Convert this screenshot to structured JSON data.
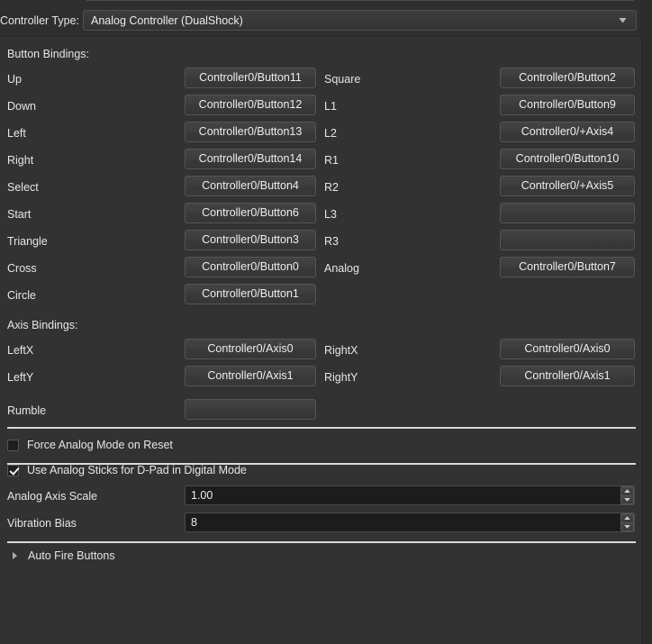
{
  "header": {
    "controller_type_label": "Controller Type:",
    "controller_type_value": "Analog Controller (DualShock)",
    "dropdown_icon": "chevron-down-icon"
  },
  "button_bindings": {
    "title": "Button Bindings:",
    "rows": [
      {
        "left_label": "Up",
        "left_binding": "Controller0/Button11",
        "right_label": "Square",
        "right_binding": "Controller0/Button2"
      },
      {
        "left_label": "Down",
        "left_binding": "Controller0/Button12",
        "right_label": "L1",
        "right_binding": "Controller0/Button9"
      },
      {
        "left_label": "Left",
        "left_binding": "Controller0/Button13",
        "right_label": "L2",
        "right_binding": "Controller0/+Axis4"
      },
      {
        "left_label": "Right",
        "left_binding": "Controller0/Button14",
        "right_label": "R1",
        "right_binding": "Controller0/Button10"
      },
      {
        "left_label": "Select",
        "left_binding": "Controller0/Button4",
        "right_label": "R2",
        "right_binding": "Controller0/+Axis5"
      },
      {
        "left_label": "Start",
        "left_binding": "Controller0/Button6",
        "right_label": "L3",
        "right_binding": ""
      },
      {
        "left_label": "Triangle",
        "left_binding": "Controller0/Button3",
        "right_label": "R3",
        "right_binding": ""
      },
      {
        "left_label": "Cross",
        "left_binding": "Controller0/Button0",
        "right_label": "Analog",
        "right_binding": "Controller0/Button7"
      },
      {
        "left_label": "Circle",
        "left_binding": "Controller0/Button1",
        "right_label": "",
        "right_binding": null
      }
    ]
  },
  "axis_bindings": {
    "title": "Axis Bindings:",
    "rows": [
      {
        "left_label": "LeftX",
        "left_binding": "Controller0/Axis0",
        "right_label": "RightX",
        "right_binding": "Controller0/Axis0"
      },
      {
        "left_label": "LeftY",
        "left_binding": "Controller0/Axis1",
        "right_label": "RightY",
        "right_binding": "Controller0/Axis1"
      }
    ]
  },
  "rumble": {
    "label": "Rumble",
    "binding": ""
  },
  "options": {
    "force_analog": {
      "label": "Force Analog Mode on Reset",
      "checked": false
    },
    "use_analog_sticks": {
      "label": "Use Analog Sticks for D-Pad in Digital Mode",
      "checked": true
    },
    "analog_axis_scale": {
      "label": "Analog Axis Scale",
      "value": "1.00"
    },
    "vibration_bias": {
      "label": "Vibration Bias",
      "value": "8"
    }
  },
  "auto_fire": {
    "label": "Auto Fire Buttons",
    "expander_icon": "triangle-right-icon",
    "expanded": false
  },
  "colors": {
    "background": "#323232",
    "button_face": "#3d3d3d",
    "input_background": "#1c1c1c",
    "separator": "#d9d9d9",
    "text": "#e6e6e6"
  }
}
